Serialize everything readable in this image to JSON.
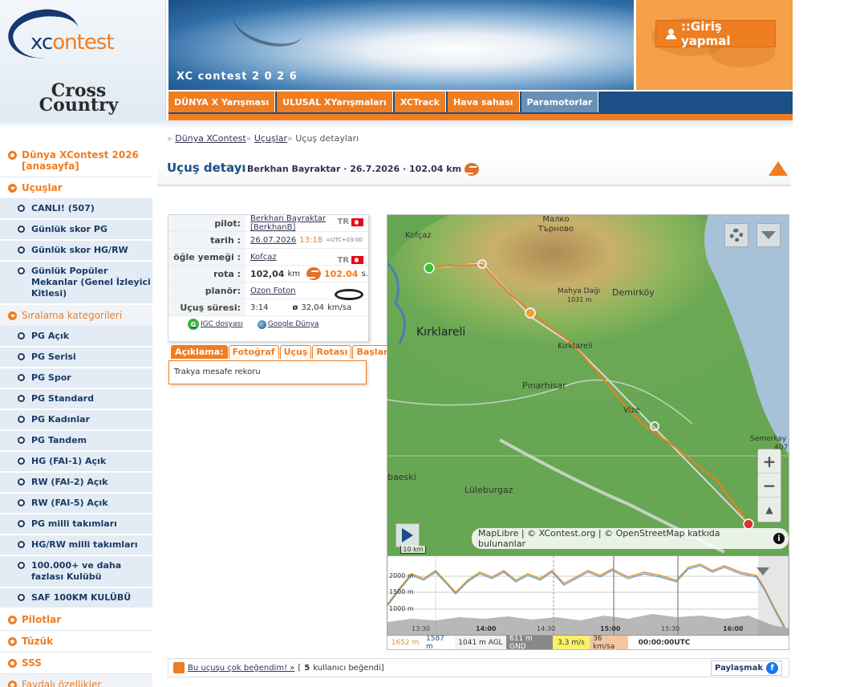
{
  "brand": {
    "logo_xc": "xcontest",
    "logo_cc": "Cross Country"
  },
  "header": {
    "banner_title": "XC contest 2 0 2 6",
    "login_label": "::Giriş yapmal"
  },
  "topnav": [
    "DÜNYA X Yarışması",
    "ULUSAL XYarışmaları",
    "XCTrack",
    "Hava sahası",
    "Paramotorlar"
  ],
  "sidebar": {
    "main_home": "Dünya XContest 2026 [anasayfa]",
    "flights": "Uçuşlar",
    "flight_items": [
      "CANLI! (507)",
      "Günlük skor PG",
      "Günlük skor HG/RW",
      "Günlük Popüler Mekanlar (Genel İzleyici Kitlesi)"
    ],
    "rankings": "Sıralama kategorileri",
    "ranking_items": [
      "PG Açık",
      "PG Serisi",
      "PG Spor",
      "PG Standard",
      "PG Kadınlar",
      "PG Tandem",
      "HG (FAI-1) Açık",
      "RW (FAI-2) Açık",
      "RW (FAI-5) Açık",
      "PG milli takımları",
      "HG/RW milli takımları",
      "100.000+ ve daha fazlası Kulübü",
      "SAF 100KM KULÜBÜ"
    ],
    "bottom": [
      "Pilotlar",
      "Tüzük",
      "SSS",
      "Faydalı özellikler"
    ]
  },
  "breadcrumb": {
    "home": "Dünya XContest",
    "flights": "Uçuşlar",
    "current": "Uçuş detayları"
  },
  "title": {
    "main": "Uçuş detayı",
    "sub": "Berkhan Bayraktar · 26.7.2026 · 102.04 km"
  },
  "info": {
    "pilot_label": "pilot:",
    "pilot_name": "Berkhan Bayraktar",
    "pilot_user": "[BerkhanB]",
    "country": "TR",
    "date_label": "tarih :",
    "date": "26.07.2026",
    "time": "13:18",
    "tz": "=UTC+03:00",
    "launch_label": "öğle yemeği :",
    "launch": "Kofçaz",
    "route_label": "rota :",
    "route_km": "102,04",
    "route_unit": "km",
    "score": "102.04",
    "score_unit": "s.",
    "glider_label": "planör:",
    "glider": "Ozon Foton",
    "duration_label": "Uçuş süresi:",
    "duration": "3:14",
    "speed_prefix": "ø",
    "speed": "32,04",
    "speed_unit": "km/sa",
    "igc_label": "IGC dosyası",
    "ge_label": "Google Dünya"
  },
  "tabs": [
    "Açıklama:",
    "Fotoğraf",
    "Uçuş",
    "Rotası",
    "Başlangıç"
  ],
  "description": "Trakya mesafe rekoru",
  "map": {
    "labels": [
      "Kofçaz",
      "Малко Търново",
      "Mahya Dağı",
      "1031 m",
      "Demirköy",
      "Kırklareli",
      "Kırklareli",
      "Pınarhisar",
      "Vize",
      "Lüleburgaz",
      "baeski",
      "Semerkay",
      "407"
    ],
    "attribution": "MapLibre | © XContest.org | © OpenStreetMap katkıda bulunanlar",
    "scale": "10 km",
    "zoom_in": "+",
    "zoom_out": "−",
    "compass": "▲"
  },
  "profile": {
    "y_labels": [
      "2000 m",
      "1500 m",
      "1000 m"
    ],
    "x_labels": [
      "13:30",
      "14:00",
      "14:30",
      "15:00",
      "15:30",
      "16:00"
    ],
    "readouts": [
      "1652 m",
      "1587 m",
      "1041 m AGL",
      "611 m GND",
      "3,3 m/s",
      "36 km/sa",
      "00:00:00UTC"
    ]
  },
  "like": {
    "link": "Bu uçuşu çok beğendim! »",
    "count_pre": "[",
    "count": "5",
    "count_post": "kullanıcı beğendi]",
    "share": "Paylaşmak"
  }
}
